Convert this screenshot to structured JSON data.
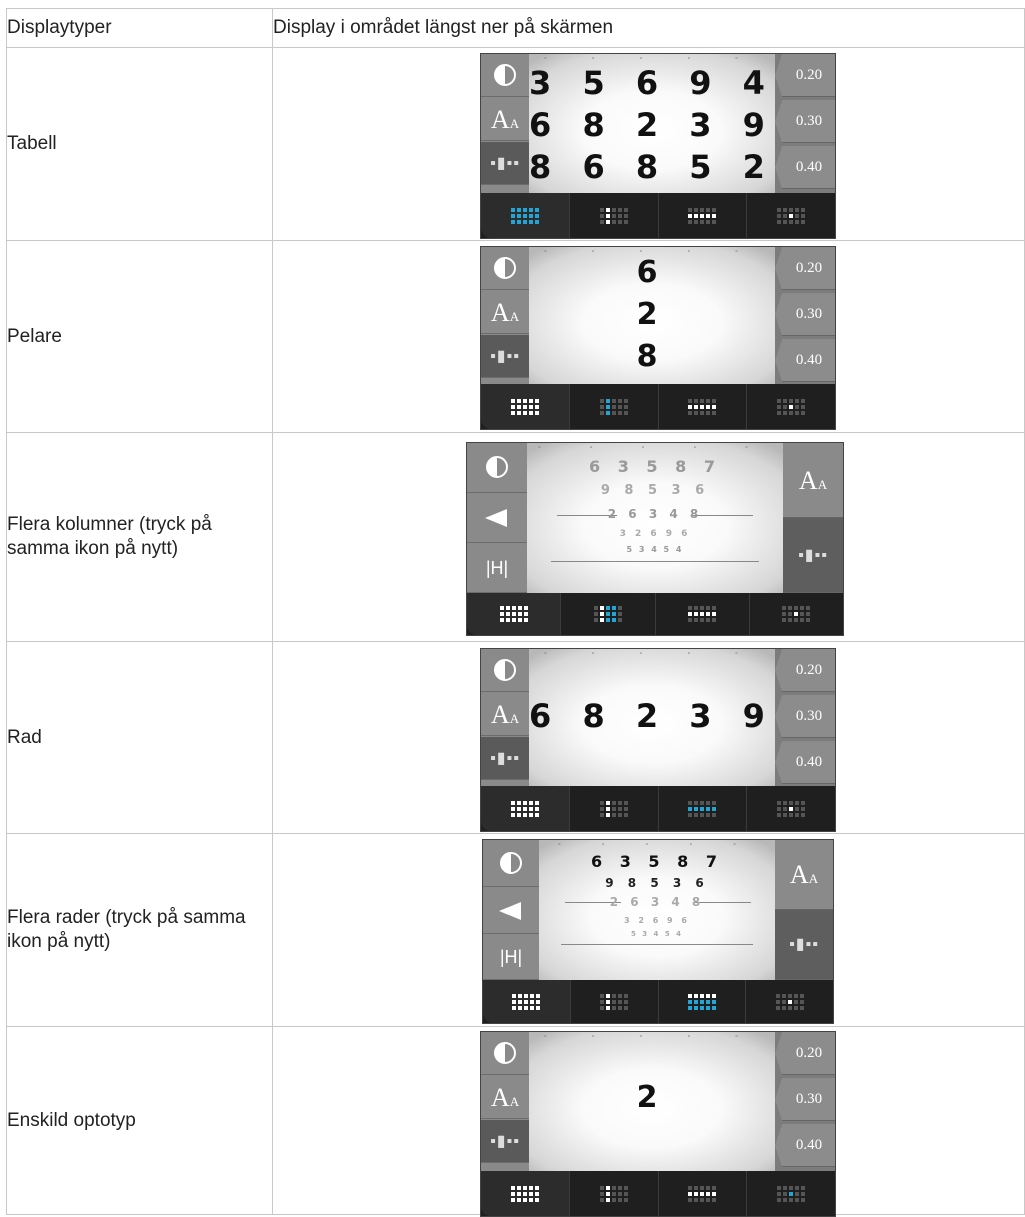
{
  "header": {
    "col1": "Displaytyper",
    "col2": "Display i området längst ner på skärmen"
  },
  "rows": [
    {
      "label": "Tabell"
    },
    {
      "label": "Pelare"
    },
    {
      "label": "Flera kolumner (tryck på samma ikon på nytt)"
    },
    {
      "label": "Rad"
    },
    {
      "label": "Flera rader (tryck på samma ikon på nytt)"
    },
    {
      "label": "Enskild optotyp"
    }
  ],
  "acuity": [
    "0.20",
    "0.30",
    "0.40"
  ],
  "screens": {
    "tabell": [
      "3 5 6 9 4",
      "6 8 2 3 9",
      "8 6 8 5 2"
    ],
    "pelare": [
      "6",
      "2",
      "8"
    ],
    "rad": "6 8 2 3 9",
    "enskild": "2",
    "multi": [
      "6 3 5 8 7",
      "9 8 5 3 6",
      "2 6 3 4 8",
      "3 2 6 9 6",
      "5 3 4 5 4"
    ]
  },
  "icons": [
    "contrast-icon",
    "font-size-icon",
    "layout-icon",
    "arrow-left-icon",
    "h-letter-icon"
  ]
}
